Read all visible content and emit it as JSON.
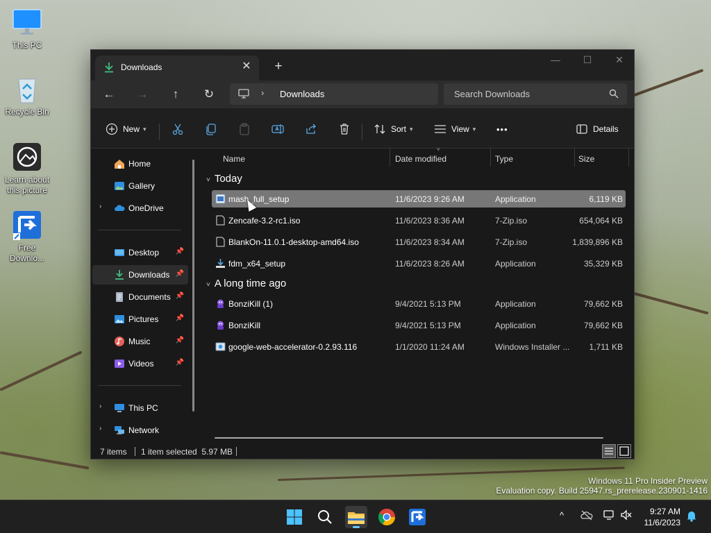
{
  "desktop": {
    "icons": [
      {
        "label": "This PC"
      },
      {
        "label": "Recycle Bin"
      },
      {
        "label": "Learn about this picture"
      },
      {
        "label": "Free Downlo..."
      }
    ],
    "watermark": {
      "line1": "Windows 11 Pro Insider Preview",
      "line2": "Evaluation copy. Build 25947.rs_prerelease.230901-1416"
    }
  },
  "window": {
    "tab_title": "Downloads",
    "tab_close": "✕",
    "new_tab": "+",
    "controls": {
      "minimize": "—",
      "maximize": "☐",
      "close": "✕"
    },
    "nav": {
      "back": "←",
      "forward": "→",
      "up": "↑",
      "refresh": "↻"
    },
    "address": {
      "chevron": "›",
      "crumb": "Downloads"
    },
    "search": {
      "placeholder": "Search Downloads"
    },
    "commands": {
      "new": "New",
      "sort": "Sort",
      "view": "View",
      "more": "•••",
      "details": "Details"
    },
    "sidebar": {
      "items": [
        {
          "label": "Home",
          "icon": "home-icon"
        },
        {
          "label": "Gallery",
          "icon": "gallery-icon"
        },
        {
          "label": "OneDrive",
          "icon": "onedrive-icon"
        },
        {
          "label": "Desktop",
          "icon": "desktop-folder-icon"
        },
        {
          "label": "Downloads",
          "icon": "downloads-folder-icon"
        },
        {
          "label": "Documents",
          "icon": "documents-folder-icon"
        },
        {
          "label": "Pictures",
          "icon": "pictures-folder-icon"
        },
        {
          "label": "Music",
          "icon": "music-folder-icon"
        },
        {
          "label": "Videos",
          "icon": "videos-folder-icon"
        },
        {
          "label": "This PC",
          "icon": "this-pc-icon"
        },
        {
          "label": "Network",
          "icon": "network-icon"
        }
      ]
    },
    "columns": {
      "name": "Name",
      "date": "Date modified",
      "type": "Type",
      "size": "Size"
    },
    "groups": {
      "today": "Today",
      "older": "A long time ago"
    },
    "files": [
      {
        "name": "mash_full_setup",
        "date": "11/6/2023 9:26 AM",
        "type": "Application",
        "size": "6,119 KB"
      },
      {
        "name": "Zencafe-3.2-rc1.iso",
        "date": "11/6/2023 8:36 AM",
        "type": "7-Zip.iso",
        "size": "654,064 KB"
      },
      {
        "name": "BlankOn-11.0.1-desktop-amd64.iso",
        "date": "11/6/2023 8:34 AM",
        "type": "7-Zip.iso",
        "size": "1,839,896 KB"
      },
      {
        "name": "fdm_x64_setup",
        "date": "11/6/2023 8:26 AM",
        "type": "Application",
        "size": "35,329 KB"
      },
      {
        "name": "BonziKill (1)",
        "date": "9/4/2021 5:13 PM",
        "type": "Application",
        "size": "79,662 KB"
      },
      {
        "name": "BonziKill",
        "date": "9/4/2021 5:13 PM",
        "type": "Application",
        "size": "79,662 KB"
      },
      {
        "name": "google-web-accelerator-0.2.93.116",
        "date": "1/1/2020 11:24 AM",
        "type": "Windows Installer ...",
        "size": "1,711 KB"
      }
    ],
    "status": {
      "count": "7 items",
      "selection": "1 item selected  5.97 MB"
    }
  },
  "taskbar": {
    "time": "9:27 AM",
    "date": "11/6/2023",
    "tray_chevron": "^"
  },
  "colors": {
    "accent": "#60cdff",
    "window_bg": "#191919",
    "selected_row": "#777777",
    "folder_yellow": "#f2c14e"
  }
}
